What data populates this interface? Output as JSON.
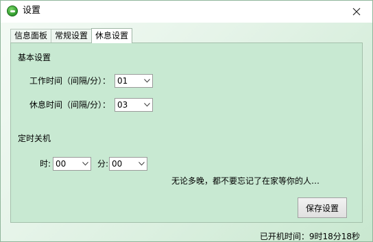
{
  "window": {
    "title": "设置",
    "close_icon": "close-icon",
    "app_icon": "app-icon"
  },
  "tabs": [
    {
      "label": "信息面板",
      "active": false
    },
    {
      "label": "常规设置",
      "active": false
    },
    {
      "label": "休息设置",
      "active": true
    }
  ],
  "rest": {
    "basic_heading": "基本设置",
    "work_label": "工作时间（间隔/分）：",
    "work_value": "01",
    "rest_label": "休息时间（间隔/分）：",
    "rest_value": "03",
    "shutdown_heading": "定时关机",
    "hour_label": "时:",
    "hour_value": "00",
    "minute_label": "分:",
    "minute_value": "00",
    "quote": "无论多晚，都不要忘记了在家等你的人…",
    "save_label": "保存设置"
  },
  "status": {
    "uptime": "已开机时间：9时18分18秒"
  }
}
